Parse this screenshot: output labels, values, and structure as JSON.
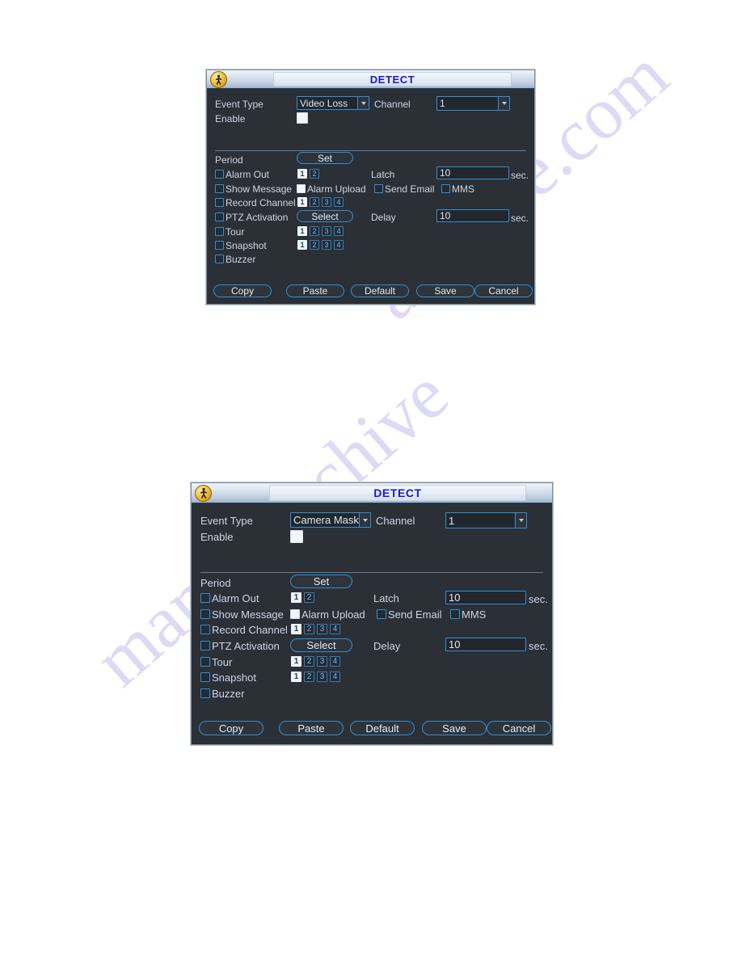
{
  "page": {
    "watermark_line_1": "archive.com",
    "watermark_line_2": "manualarchive"
  },
  "dialogs": [
    {
      "id": "detect-video-loss",
      "title": "DETECT",
      "icon": "walking-person-icon",
      "fields": {
        "event_type_label": "Event Type",
        "event_type_value": "Video Loss",
        "channel_label": "Channel",
        "channel_value": "1",
        "enable_label": "Enable",
        "enable_checked": true,
        "period_label": "Period",
        "period_button": "Set",
        "alarm_out_label": "Alarm Out",
        "alarm_out_checked": false,
        "alarm_out_channels": [
          {
            "n": "1",
            "selected": true
          },
          {
            "n": "2",
            "selected": false
          }
        ],
        "latch_label": "Latch",
        "latch_value": "10",
        "latch_unit": "sec.",
        "show_message_label": "Show Message",
        "show_message_checked": false,
        "alarm_upload_label": "Alarm Upload",
        "alarm_upload_checked": true,
        "send_email_label": "Send Email",
        "send_email_checked": false,
        "mms_label": "MMS",
        "mms_checked": false,
        "record_channel_label": "Record Channel",
        "record_channel_checked": false,
        "record_channels": [
          {
            "n": "1",
            "selected": true
          },
          {
            "n": "2",
            "selected": false
          },
          {
            "n": "3",
            "selected": false
          },
          {
            "n": "4",
            "selected": false
          }
        ],
        "ptz_activation_label": "PTZ Activation",
        "ptz_activation_checked": false,
        "ptz_button": "Select",
        "delay_label": "Delay",
        "delay_value": "10",
        "delay_unit": "sec.",
        "tour_label": "Tour",
        "tour_checked": false,
        "tour_channels": [
          {
            "n": "1",
            "selected": true
          },
          {
            "n": "2",
            "selected": false
          },
          {
            "n": "3",
            "selected": false
          },
          {
            "n": "4",
            "selected": false
          }
        ],
        "snapshot_label": "Snapshot",
        "snapshot_checked": false,
        "snapshot_channels": [
          {
            "n": "1",
            "selected": true
          },
          {
            "n": "2",
            "selected": false
          },
          {
            "n": "3",
            "selected": false
          },
          {
            "n": "4",
            "selected": false
          }
        ],
        "buzzer_label": "Buzzer",
        "buzzer_checked": false
      },
      "footer": {
        "copy": "Copy",
        "paste": "Paste",
        "default": "Default",
        "save": "Save",
        "cancel": "Cancel"
      }
    },
    {
      "id": "detect-camera-masking",
      "title": "DETECT",
      "icon": "walking-person-icon",
      "fields": {
        "event_type_label": "Event Type",
        "event_type_value": "Camera Maski",
        "channel_label": "Channel",
        "channel_value": "1",
        "enable_label": "Enable",
        "enable_checked": true,
        "period_label": "Period",
        "period_button": "Set",
        "alarm_out_label": "Alarm Out",
        "alarm_out_checked": false,
        "alarm_out_channels": [
          {
            "n": "1",
            "selected": true
          },
          {
            "n": "2",
            "selected": false
          }
        ],
        "latch_label": "Latch",
        "latch_value": "10",
        "latch_unit": "sec.",
        "show_message_label": "Show Message",
        "show_message_checked": false,
        "alarm_upload_label": "Alarm Upload",
        "alarm_upload_checked": true,
        "send_email_label": "Send Email",
        "send_email_checked": false,
        "mms_label": "MMS",
        "mms_checked": false,
        "record_channel_label": "Record Channel",
        "record_channel_checked": false,
        "record_channels": [
          {
            "n": "1",
            "selected": true
          },
          {
            "n": "2",
            "selected": false
          },
          {
            "n": "3",
            "selected": false
          },
          {
            "n": "4",
            "selected": false
          }
        ],
        "ptz_activation_label": "PTZ Activation",
        "ptz_activation_checked": false,
        "ptz_button": "Select",
        "delay_label": "Delay",
        "delay_value": "10",
        "delay_unit": "sec.",
        "tour_label": "Tour",
        "tour_checked": false,
        "tour_channels": [
          {
            "n": "1",
            "selected": true
          },
          {
            "n": "2",
            "selected": false
          },
          {
            "n": "3",
            "selected": false
          },
          {
            "n": "4",
            "selected": false
          }
        ],
        "snapshot_label": "Snapshot",
        "snapshot_checked": false,
        "snapshot_channels": [
          {
            "n": "1",
            "selected": true
          },
          {
            "n": "2",
            "selected": false
          },
          {
            "n": "3",
            "selected": false
          },
          {
            "n": "4",
            "selected": false
          }
        ],
        "buzzer_label": "Buzzer",
        "buzzer_checked": false
      },
      "footer": {
        "copy": "Copy",
        "paste": "Paste",
        "default": "Default",
        "save": "Save",
        "cancel": "Cancel"
      }
    }
  ]
}
